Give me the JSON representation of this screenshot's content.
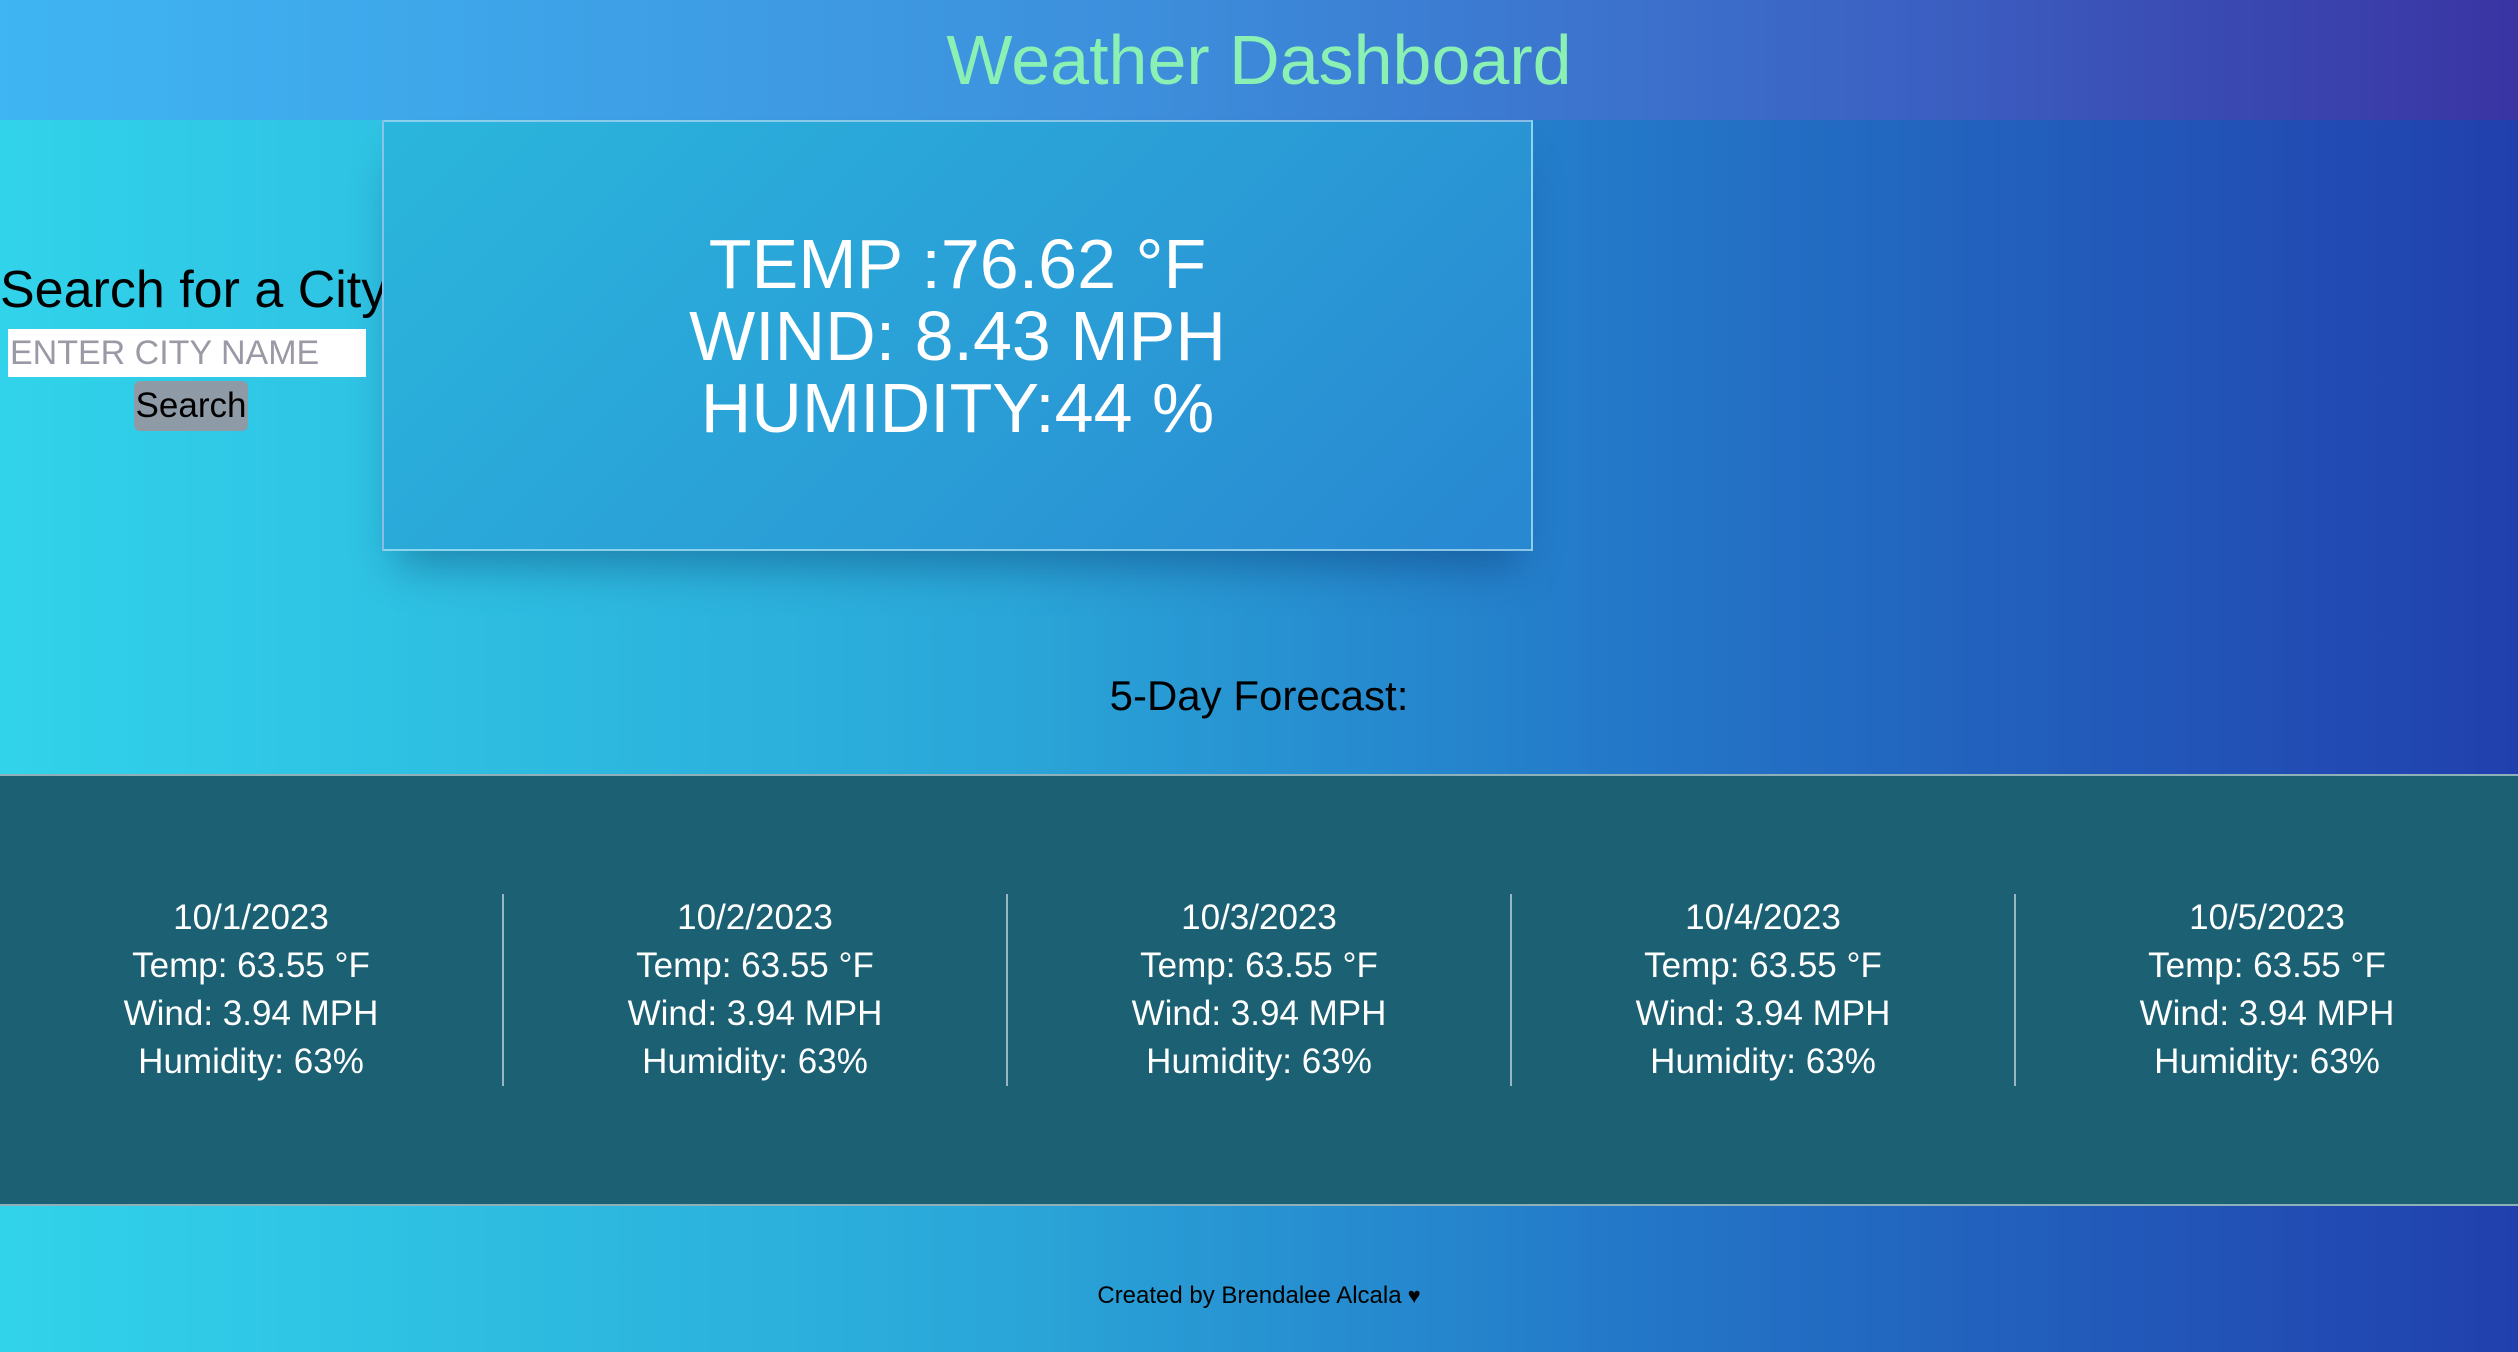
{
  "header": {
    "title": "Weather Dashboard"
  },
  "search": {
    "label": "Search for a City:",
    "placeholder": "ENTER CITY NAME",
    "value": "",
    "button_label": "Search"
  },
  "current": {
    "temp": "TEMP :76.62 °F",
    "wind": "WIND: 8.43 MPH",
    "humidity": "HUMIDITY:44 %"
  },
  "forecast": {
    "title": "5-Day Forecast:",
    "days": [
      {
        "date": "10/1/2023",
        "temp": "Temp: 63.55 °F",
        "wind": "Wind: 3.94 MPH",
        "humidity": "Humidity: 63%"
      },
      {
        "date": "10/2/2023",
        "temp": "Temp: 63.55 °F",
        "wind": "Wind: 3.94 MPH",
        "humidity": "Humidity: 63%"
      },
      {
        "date": "10/3/2023",
        "temp": "Temp: 63.55 °F",
        "wind": "Wind: 3.94 MPH",
        "humidity": "Humidity: 63%"
      },
      {
        "date": "10/4/2023",
        "temp": "Temp: 63.55 °F",
        "wind": "Wind: 3.94 MPH",
        "humidity": "Humidity: 63%"
      },
      {
        "date": "10/5/2023",
        "temp": "Temp: 63.55 °F",
        "wind": "Wind: 3.94 MPH",
        "humidity": "Humidity: 63%"
      }
    ]
  },
  "footer": {
    "text": "Created by Brendalee Alcala",
    "icon": "heart-icon"
  },
  "colors": {
    "title": "#8bf0b4",
    "forecast_bg": "#1c6073",
    "button_bg": "#8e9aa6"
  }
}
